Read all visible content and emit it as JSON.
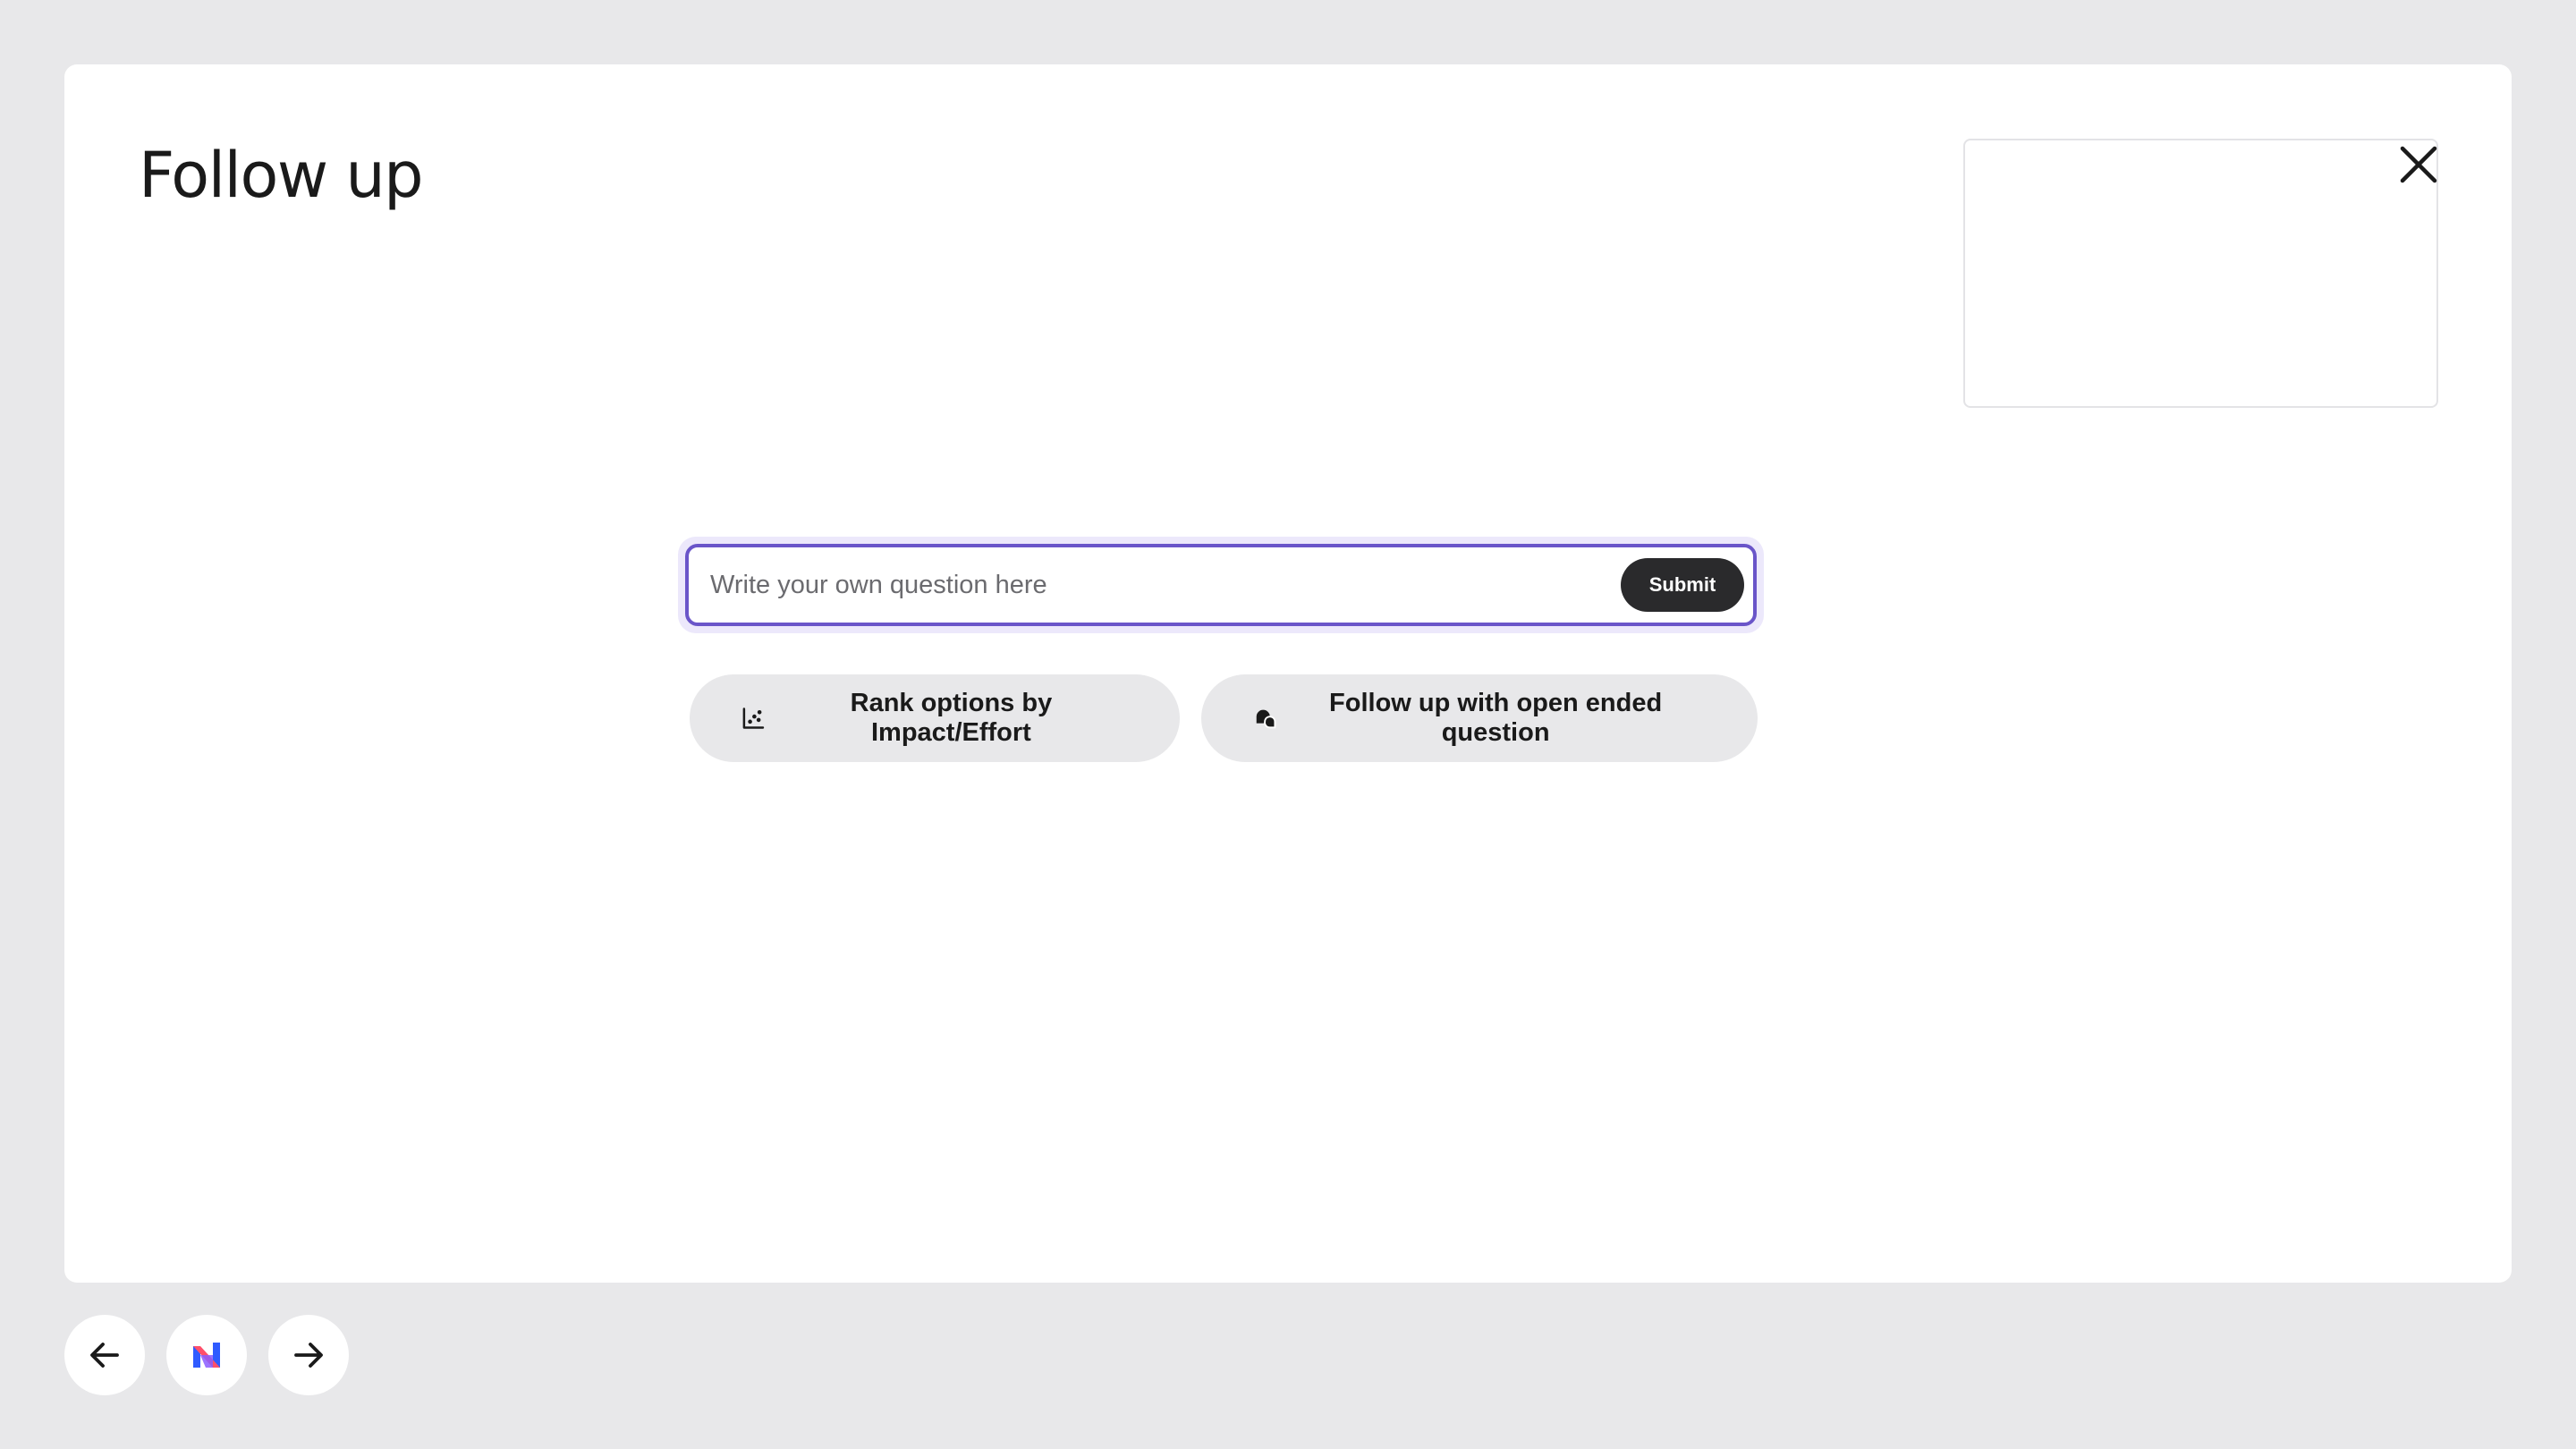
{
  "page": {
    "title": "Follow up"
  },
  "close": {
    "icon": "close-icon"
  },
  "question": {
    "placeholder": "Write your own question here",
    "value": "",
    "submit_label": "Submit",
    "focus_color": "#6a55c9"
  },
  "suggestions": [
    {
      "label": "Rank options by Impact/Effort",
      "icon": "scatter-chart-icon"
    },
    {
      "label": "Follow up with open ended question",
      "icon": "chat-bubbles-icon"
    }
  ],
  "navigation": {
    "back_icon": "arrow-left-icon",
    "logo": "app-logo",
    "forward_icon": "arrow-right-icon"
  }
}
